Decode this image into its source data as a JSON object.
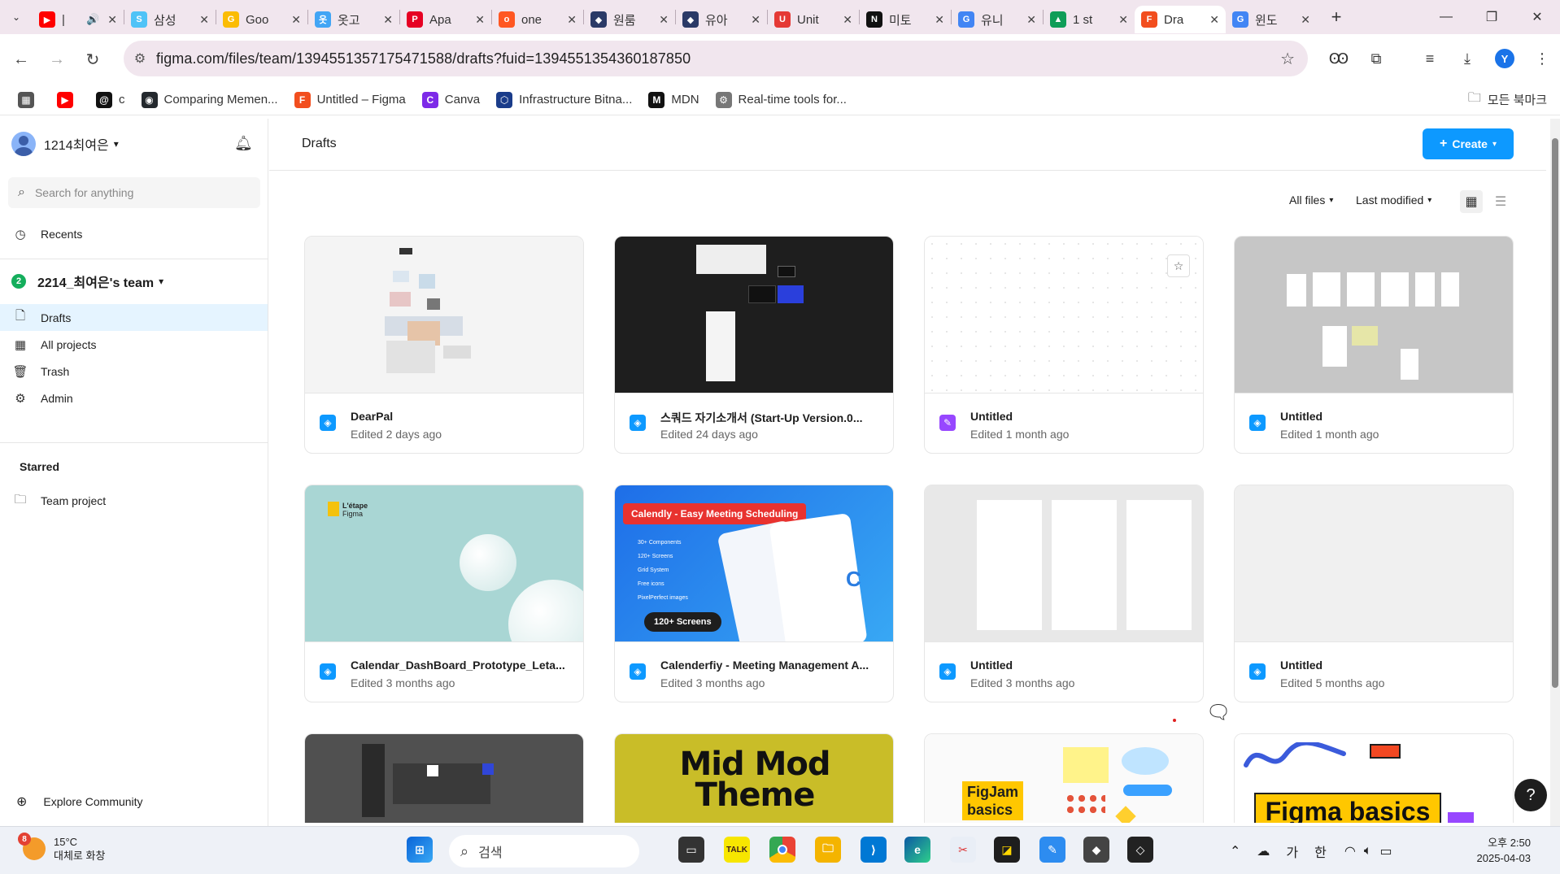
{
  "browser": {
    "tabs": [
      {
        "label": "|",
        "icon": "youtube-icon",
        "color": "#ff0000",
        "glyph": "▶",
        "extra": "🔊"
      },
      {
        "label": "삼성",
        "icon": "app-icon",
        "color": "#4fc3f7",
        "glyph": "S"
      },
      {
        "label": "Goo",
        "icon": "google-lens-icon",
        "color": "#fbbc04",
        "glyph": "G"
      },
      {
        "label": "옷고",
        "icon": "app-icon",
        "color": "#42a5f5",
        "glyph": "옷"
      },
      {
        "label": "Apa",
        "icon": "pinterest-icon",
        "color": "#e60023",
        "glyph": "P"
      },
      {
        "label": "one",
        "icon": "app-icon",
        "color": "#ff5722",
        "glyph": "o"
      },
      {
        "label": "원룸",
        "icon": "unity-icon",
        "color": "#2b3a67",
        "glyph": "◆"
      },
      {
        "label": "유아",
        "icon": "unity-icon",
        "color": "#2b3a67",
        "glyph": "◆"
      },
      {
        "label": "Unit",
        "icon": "app-icon",
        "color": "#e53935",
        "glyph": "U"
      },
      {
        "label": "미토",
        "icon": "notion-icon",
        "color": "#111111",
        "glyph": "N"
      },
      {
        "label": "유니",
        "icon": "google-icon",
        "color": "#4285f4",
        "glyph": "G"
      },
      {
        "label": "1 st",
        "icon": "google-drive-icon",
        "color": "#0f9d58",
        "glyph": "▲"
      },
      {
        "label": "Dra",
        "icon": "figma-icon",
        "color": "#f24e1e",
        "glyph": "F",
        "active": true
      },
      {
        "label": "윈도",
        "icon": "google-icon",
        "color": "#4285f4",
        "glyph": "G"
      }
    ],
    "new_tab": "+",
    "url": "figma.com/files/team/1394551357175471588/drafts?fuid=1394551354360187850",
    "profile_initial": "Y",
    "bookmarks": [
      {
        "label": "",
        "icon": "apps-grid-icon"
      },
      {
        "label": "",
        "icon": "youtube-icon"
      },
      {
        "label": "c",
        "icon": "threads-icon"
      },
      {
        "label": "Comparing Memen...",
        "icon": "github-icon"
      },
      {
        "label": "Untitled – Figma",
        "icon": "figma-icon"
      },
      {
        "label": "Canva",
        "icon": "canva-icon"
      },
      {
        "label": "Infrastructure Bitna...",
        "icon": "bitnami-icon"
      },
      {
        "label": "MDN",
        "icon": "mdn-icon"
      },
      {
        "label": "Real-time tools for...",
        "icon": "gear-icon"
      }
    ],
    "all_bookmarks": "모든 북마크"
  },
  "sidebar": {
    "user_name": "1214최여은",
    "search_placeholder": "Search for anything",
    "recents": "Recents",
    "team_badge": "2",
    "team_name": "2214_최여은's team",
    "items": [
      {
        "label": "Drafts",
        "icon": "file-icon",
        "selected": true
      },
      {
        "label": "All projects",
        "icon": "grid-icon"
      },
      {
        "label": "Trash",
        "icon": "trash-icon"
      },
      {
        "label": "Admin",
        "icon": "settings-icon"
      }
    ],
    "starred_heading": "Starred",
    "starred_items": [
      {
        "label": "Team project",
        "icon": "folder-icon"
      }
    ],
    "explore": "Explore Community"
  },
  "main": {
    "title": "Drafts",
    "create_label": "Create",
    "filter_files": "All files",
    "filter_sort": "Last modified",
    "files": [
      {
        "name": "DearPal",
        "edited": "Edited 2 days ago",
        "kind": "design"
      },
      {
        "name": "스쿼드 자기소개서 (Start-Up Version.0...",
        "edited": "Edited 24 days ago",
        "kind": "design"
      },
      {
        "name": "Untitled",
        "edited": "Edited 1 month ago",
        "kind": "figjam"
      },
      {
        "name": "Untitled",
        "edited": "Edited 1 month ago",
        "kind": "design"
      },
      {
        "name": "Calendar_DashBoard_Prototype_Leta...",
        "edited": "Edited 3 months ago",
        "kind": "design"
      },
      {
        "name": "Calenderfiy - Meeting Management A...",
        "edited": "Edited 3 months ago",
        "kind": "design"
      },
      {
        "name": "Untitled",
        "edited": "Edited 3 months ago",
        "kind": "design"
      },
      {
        "name": "Untitled",
        "edited": "Edited 5 months ago",
        "kind": "design"
      }
    ],
    "thumb_text": {
      "letape": "L'étape",
      "letape_sub": "Figma",
      "calendly_banner": "Calendly - Easy Meeting Scheduling",
      "calendly_features": [
        "30+ Components",
        "120+ Screens",
        "Grid System",
        "Free icons",
        "PixelPerfect images"
      ],
      "calendly_badge": "120+ Screens",
      "midmod_line1": "Mid Mod",
      "midmod_line2": "Theme",
      "figjam_label": "FigJam",
      "figjam_label2": "basics",
      "figma_basics": "Figma basics"
    },
    "help": "?"
  },
  "taskbar": {
    "weather_temp": "15°C",
    "weather_desc": "대체로 화창",
    "weather_badge": "8",
    "search_label": "검색",
    "ime_1": "가",
    "ime_2": "한",
    "time": "오후 2:50",
    "date": "2025-04-03"
  }
}
